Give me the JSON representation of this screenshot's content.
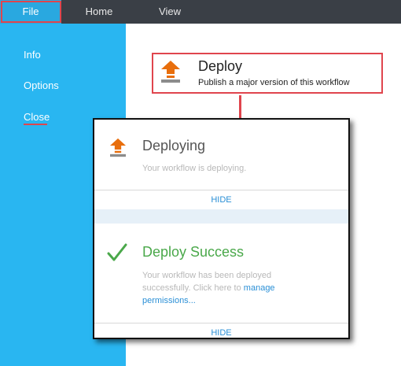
{
  "menubar": {
    "items": [
      {
        "label": "File"
      },
      {
        "label": "Home"
      },
      {
        "label": "View"
      }
    ]
  },
  "sidebar": {
    "items": [
      {
        "label": "Info"
      },
      {
        "label": "Options"
      },
      {
        "label": "Close"
      }
    ]
  },
  "deploy_card": {
    "title": "Deploy",
    "subtitle": "Publish a major version of this workflow",
    "icon": "deploy-upload-icon"
  },
  "popup": {
    "deploying": {
      "title": "Deploying",
      "message": "Your workflow is deploying.",
      "hide_label": "HIDE"
    },
    "success": {
      "title": "Deploy Success",
      "message_prefix": "Your workflow has been deployed successfully. Click here to ",
      "link_label": "manage permissions...",
      "hide_label": "HIDE"
    }
  },
  "colors": {
    "topbar": "#3a3f46",
    "sidebar": "#29b6f1",
    "highlight": "#e0454d",
    "accent_orange": "#e86e0c",
    "success_green": "#4aa84a",
    "link_blue": "#2a8fd6"
  }
}
